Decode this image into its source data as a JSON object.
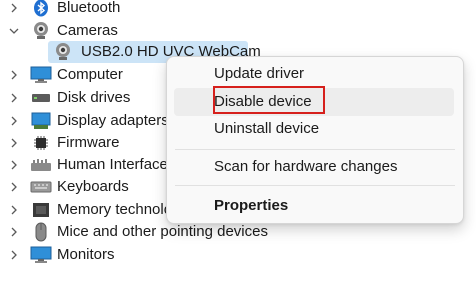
{
  "tree": {
    "items": [
      {
        "label": "Bluetooth",
        "icon": "bluetooth-icon",
        "expanded": false
      },
      {
        "label": "Cameras",
        "icon": "camera-icon",
        "expanded": true,
        "children": [
          {
            "label": "USB2.0 HD UVC WebCam",
            "icon": "webcam-icon",
            "selected": true
          }
        ]
      },
      {
        "label": "Computer",
        "icon": "computer-icon",
        "expanded": false
      },
      {
        "label": "Disk drives",
        "icon": "disk-drive-icon",
        "expanded": false
      },
      {
        "label": "Display adapters",
        "icon": "display-adapter-icon",
        "expanded": false
      },
      {
        "label": "Firmware",
        "icon": "firmware-icon",
        "expanded": false
      },
      {
        "label": "Human Interface Devices",
        "icon": "hid-icon",
        "expanded": false
      },
      {
        "label": "Keyboards",
        "icon": "keyboard-icon",
        "expanded": false
      },
      {
        "label": "Memory technology devices",
        "icon": "memory-icon",
        "expanded": false
      },
      {
        "label": "Mice and other pointing devices",
        "icon": "mouse-icon",
        "expanded": false
      },
      {
        "label": "Monitors",
        "icon": "monitor-icon",
        "expanded": false
      }
    ]
  },
  "context_menu": {
    "items": [
      {
        "label": "Update driver"
      },
      {
        "label": "Disable device",
        "highlighted": true
      },
      {
        "label": "Uninstall device"
      },
      {
        "separator": true
      },
      {
        "label": "Scan for hardware changes"
      },
      {
        "separator": true
      },
      {
        "label": "Properties",
        "bold": true
      }
    ]
  },
  "colors": {
    "selection": "#cce4f7",
    "annotation": "#d6201c",
    "menu_bg": "#f9f9f9"
  }
}
